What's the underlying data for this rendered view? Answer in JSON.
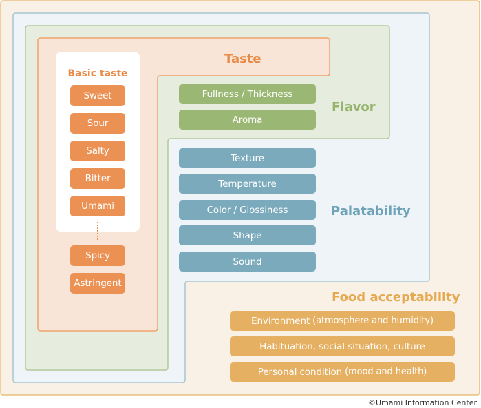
{
  "colors": {
    "taste": "#EC9154",
    "taste_title": "#EA8A47",
    "taste_fill": "#F8E5D8",
    "taste_stroke": "#EEA36E",
    "flavor": "#9AB874",
    "flavor_title": "#96B46D",
    "flavor_fill": "#E6EDDF",
    "flavor_stroke": "#B1C99A",
    "palatability": "#7AAABC",
    "palatability_title": "#6FA3B8",
    "palatability_fill": "#EEF4F7",
    "palatability_stroke": "#A6C5D2",
    "food": "#E6B062",
    "food_title": "#E5A952",
    "food_fill": "#FAF1E6",
    "food_stroke": "#E8BE7A"
  },
  "taste": {
    "title": "Taste",
    "basic_taste_label": "Basic taste",
    "basic_tastes": [
      "Sweet",
      "Sour",
      "Salty",
      "Bitter",
      "Umami"
    ],
    "ellipsis": "dotted-continuation",
    "other_tastes": [
      "Spicy",
      "Astringent"
    ]
  },
  "flavor": {
    "title": "Flavor",
    "items": [
      "Fullness / Thickness",
      "Aroma"
    ]
  },
  "palatability": {
    "title": "Palatability",
    "items": [
      "Texture",
      "Temperature",
      "Color / Glossiness",
      "Shape",
      "Sound"
    ]
  },
  "food_acceptability": {
    "title": "Food acceptability",
    "items": [
      {
        "main": "Environment",
        "sub": "(atmosphere and humidity)"
      },
      {
        "main": "Habituation, social situation, culture",
        "sub": ""
      },
      {
        "main": "Personal condition",
        "sub": "(mood and health)"
      }
    ]
  },
  "credit": "©Umami Information Center"
}
